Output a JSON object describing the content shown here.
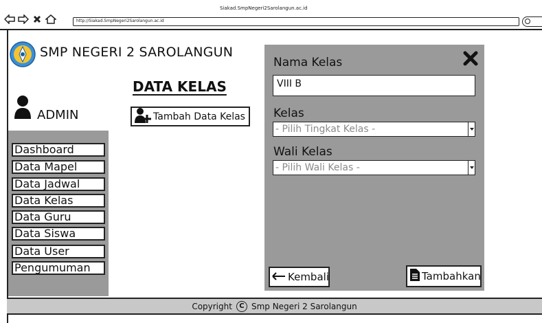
{
  "browser": {
    "window_title": "Siakad.SmpNegeri2Sarolangun.ac.id",
    "url": "http://Siakad.SmpNegeri2Sarolangun.ac.id"
  },
  "header": {
    "school_name": "SMP NEGERI 2 SAROLANGUN"
  },
  "page": {
    "title": "DATA KELAS",
    "add_button_label": "Tambah Data Kelas"
  },
  "user": {
    "name": "ADMIN"
  },
  "sidebar": {
    "items": [
      {
        "label": "Dashboard"
      },
      {
        "label": "Data Mapel"
      },
      {
        "label": "Data Jadwal"
      },
      {
        "label": "Data Kelas"
      },
      {
        "label": "Data Guru"
      },
      {
        "label": "Data Siswa"
      },
      {
        "label": "Data User"
      },
      {
        "label": "Pengumuman"
      }
    ]
  },
  "modal": {
    "nama_kelas_label": "Nama Kelas",
    "nama_kelas_value": "VIII B",
    "kelas_label": "Kelas",
    "kelas_select_value": "- Pilih Tingkat Kelas -",
    "wali_kelas_label": "Wali Kelas",
    "wali_kelas_select_value": "- Pilih Wali Kelas -",
    "back_button_label": "Kembali",
    "submit_button_label": "Tambahkan"
  },
  "footer": {
    "copyright_label": "Copyright",
    "copyright_owner": "Smp Negeri 2 Sarolangun"
  },
  "colors": {
    "panel_gray": "#9a9a9a",
    "footer_gray": "#c8c8c8",
    "border": "#222222"
  }
}
